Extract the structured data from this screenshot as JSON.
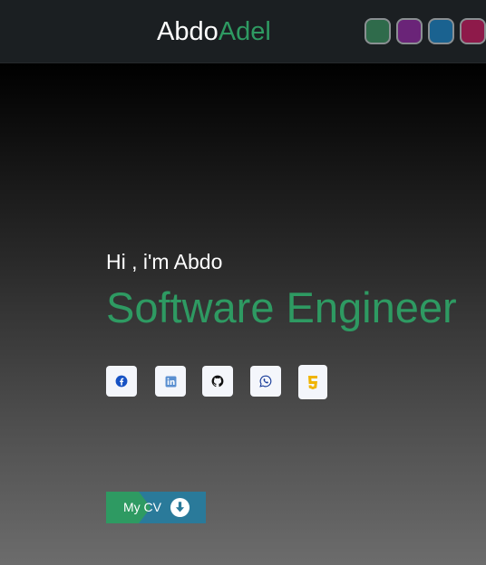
{
  "brand": {
    "first": "Abdo",
    "second": "Adel"
  },
  "theme_swatches": [
    {
      "name": "green",
      "color": "#2f6b4b"
    },
    {
      "name": "purple",
      "color": "#6a2478"
    },
    {
      "name": "blue",
      "color": "#1a6290"
    },
    {
      "name": "crimson",
      "color": "#8e1a4a"
    }
  ],
  "hero": {
    "greeting": "Hi , i'm Abdo",
    "role": "Software Engineer"
  },
  "social_links": [
    {
      "name": "facebook-icon",
      "color": "#1652c4"
    },
    {
      "name": "linkedin-icon",
      "color": "#5a8fd0"
    },
    {
      "name": "github-icon",
      "color": "#111111"
    },
    {
      "name": "whatsapp-icon",
      "color": "#1a3d9a"
    },
    {
      "name": "html5-icon",
      "color": "#f0b400"
    }
  ],
  "cv_button": {
    "label": "My CV",
    "icon": "download-icon"
  }
}
